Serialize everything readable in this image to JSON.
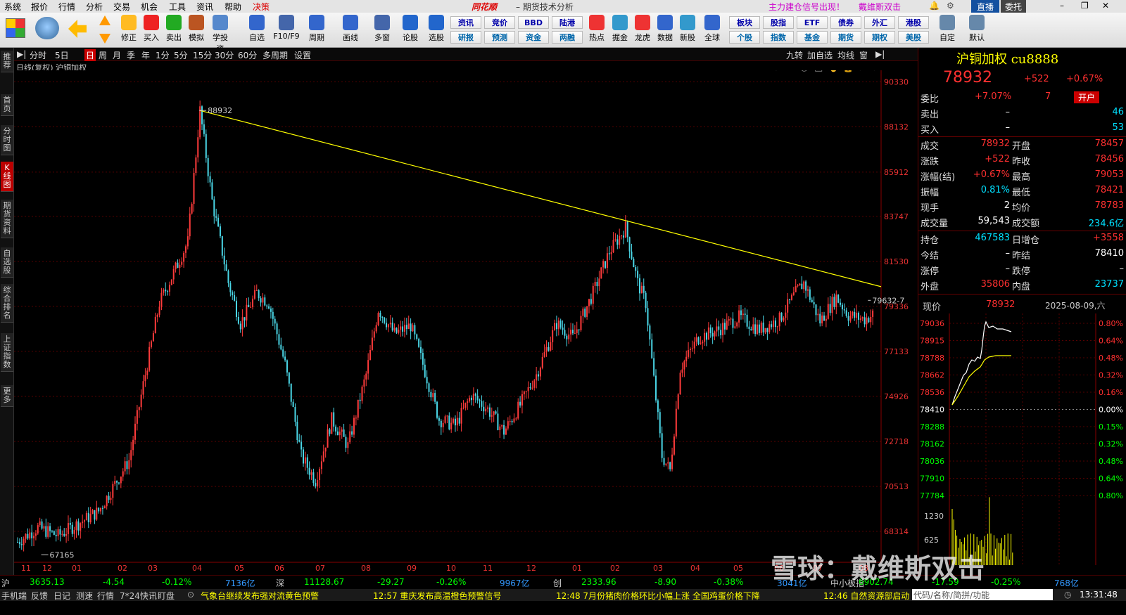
{
  "menu": [
    "系统",
    "报价",
    "行情",
    "分析",
    "交易",
    "机会",
    "工具",
    "资讯",
    "帮助",
    "决策"
  ],
  "app_logo": "同花顺",
  "window_title": "期货技术分析",
  "alert_text": "主力建仓信号出现！",
  "user_name": "戴维斯双击",
  "direct_btn": "直播",
  "entrust_btn": "委托",
  "toolbar_left": [
    {
      "label": "修正",
      "icon": "up-arrow-icon"
    },
    {
      "label": "买入",
      "icon": "buy-icon"
    },
    {
      "label": "卖出",
      "icon": "sell-icon"
    },
    {
      "label": "模拟",
      "icon": "hammer-icon"
    },
    {
      "label": "学投资",
      "icon": "graduation-icon"
    },
    {
      "label": "自选",
      "icon": "star-icon"
    },
    {
      "label": "F10/F9",
      "icon": "f10-icon"
    },
    {
      "label": "周期",
      "icon": "clock-icon"
    },
    {
      "label": "画线",
      "icon": "pen-icon"
    },
    {
      "label": "多窗",
      "icon": "windows-icon"
    },
    {
      "label": "论股",
      "icon": "forum-icon"
    },
    {
      "label": "选股",
      "icon": "select-icon"
    }
  ],
  "toolbar_grid": [
    [
      "资讯",
      "竞价",
      "BBD",
      "陆港"
    ],
    [
      "研报",
      "预测",
      "资金",
      "两融"
    ]
  ],
  "toolbar_mid": [
    "热点",
    "掘金",
    "龙虎",
    "数据",
    "新股",
    "全球"
  ],
  "toolbar_grid2": [
    [
      "板块",
      "股指",
      "ETF",
      "债券",
      "外汇",
      "港股"
    ],
    [
      "个股",
      "指数",
      "基金",
      "期货",
      "期权",
      "美股"
    ]
  ],
  "toolbar_right": [
    "自定",
    "默认"
  ],
  "left_tabs": [
    "推荐",
    "首页",
    "分时图",
    "K线图",
    "期货资料",
    "自选股",
    "综合排名",
    "上证指数",
    "更多"
  ],
  "periods": [
    "分时",
    "5日",
    "日",
    "周",
    "月",
    "季",
    "年",
    "1分",
    "5分",
    "15分",
    "30分",
    "60分",
    "多周期",
    "设置"
  ],
  "period_selected": "日",
  "right_tools": [
    "九转",
    "加自选",
    "均线",
    "窗"
  ],
  "chart_title": "日线(复权)  沪铜加权",
  "quote": {
    "name": "沪铜加权 cu8888",
    "price": "78932",
    "change": "+522",
    "pct": "+0.67%",
    "weibi_k": "委比",
    "weibi_v": "+7.07%",
    "weibi_n": "7",
    "open_btn": "开户",
    "sell_k": "卖出",
    "sell_v": "–",
    "sell_n": "46",
    "buy_k": "买入",
    "buy_v": "–",
    "buy_n": "53",
    "rows": [
      [
        "成交",
        "78932",
        "开盘",
        "78457"
      ],
      [
        "涨跌",
        "+522",
        "昨收",
        "78456"
      ],
      [
        "涨幅(结)",
        "+0.67%",
        "最高",
        "79053"
      ],
      [
        "振幅",
        "0.81%",
        "最低",
        "78421"
      ],
      [
        "现手",
        "2",
        "均价",
        "78783"
      ],
      [
        "成交量",
        "59,543",
        "成交额",
        "234.6亿"
      ],
      [
        "持仓",
        "467583",
        "日增仓",
        "+3558"
      ],
      [
        "今结",
        "–",
        "昨结",
        "78410"
      ],
      [
        "涨停",
        "–",
        "跌停",
        "–"
      ],
      [
        "外盘",
        "35806",
        "内盘",
        "23737"
      ]
    ],
    "now_label": "现价",
    "now_price": "78932",
    "date": "2025-08-09,六"
  },
  "mini_axis_left": [
    "79036",
    "78915",
    "78788",
    "78662",
    "78536",
    "78410",
    "78288",
    "78162",
    "78036",
    "77910",
    "77784"
  ],
  "mini_axis_right": [
    "0.80%",
    "0.64%",
    "0.48%",
    "0.32%",
    "0.16%",
    "0.00%",
    "0.15%",
    "0.32%",
    "0.48%",
    "0.64%",
    "0.80%"
  ],
  "mini_vol_axis": [
    "1230",
    "625"
  ],
  "status": {
    "sh_label": "沪",
    "sh_val": "3635.13",
    "sh_chg": "-4.54",
    "sh_pct": "-0.12%",
    "sh_amt": "7136亿",
    "sz_label": "深",
    "sz_val": "11128.67",
    "sz_chg": "-29.27",
    "sz_pct": "-0.26%",
    "sz_amt": "9967亿",
    "cy_label": "创",
    "cy_val": "2333.96",
    "cy_chg": "-8.90",
    "cy_pct": "-0.38%",
    "cy_amt": "3041亿",
    "zx_label": "中小板指",
    "zx_val": "6902.74",
    "zx_chg": "-17.59",
    "zx_pct": "-0.25%",
    "zx_amt": "768亿"
  },
  "bottom": {
    "tabs": [
      "手机端",
      "反馈",
      "日记",
      "测速",
      "行情",
      "7*24快讯",
      "盯盘"
    ],
    "news": [
      "气象台继续发布强对流黄色预警",
      "12:57 重庆发布高温橙色预警信号",
      "12:48 7月份猪肉价格环比小幅上涨 全国鸡蛋价格下降",
      "12:46 自然资源部启动"
    ],
    "search_placeholder": "代码/名称/简拼/功能",
    "clock": "13:31:48"
  },
  "watermark": "雪球：戴维斯双击",
  "chart_data": {
    "type": "candlestick",
    "y_ticks": [
      90330,
      88132,
      85912,
      83747,
      81530,
      79336,
      77133,
      74926,
      72718,
      70513,
      68314
    ],
    "x_ticks": [
      "11",
      "12",
      "01",
      "02",
      "03",
      "04",
      "05",
      "06",
      "07",
      "08",
      "09",
      "10",
      "11",
      "12",
      "01",
      "02",
      "03",
      "04",
      "05",
      "06",
      "07",
      "08"
    ],
    "annotations": [
      {
        "label": "88932",
        "value": 88932
      },
      {
        "label": "67165",
        "value": 67165
      },
      {
        "label": "79632-7",
        "value": 79632
      }
    ],
    "trendline": {
      "from": 88932,
      "to": 80300
    },
    "keypoints": [
      [
        0,
        67800
      ],
      [
        10,
        68500
      ],
      [
        20,
        68100
      ],
      [
        40,
        69300
      ],
      [
        55,
        71800
      ],
      [
        62,
        75500
      ],
      [
        70,
        79500
      ],
      [
        78,
        81200
      ],
      [
        84,
        82500
      ],
      [
        90,
        88932
      ],
      [
        96,
        84500
      ],
      [
        104,
        80500
      ],
      [
        110,
        78500
      ],
      [
        118,
        80000
      ],
      [
        124,
        79500
      ],
      [
        132,
        76500
      ],
      [
        140,
        72000
      ],
      [
        147,
        70800
      ],
      [
        155,
        73800
      ],
      [
        163,
        72500
      ],
      [
        172,
        76000
      ],
      [
        178,
        79200
      ],
      [
        186,
        78000
      ],
      [
        194,
        78400
      ],
      [
        200,
        76500
      ],
      [
        208,
        73800
      ],
      [
        216,
        73500
      ],
      [
        224,
        75000
      ],
      [
        232,
        74300
      ],
      [
        240,
        73200
      ],
      [
        248,
        74500
      ],
      [
        256,
        76000
      ],
      [
        266,
        78500
      ],
      [
        274,
        77800
      ],
      [
        284,
        80000
      ],
      [
        292,
        82000
      ],
      [
        300,
        83200
      ],
      [
        306,
        80500
      ],
      [
        310,
        79500
      ],
      [
        318,
        72000
      ],
      [
        322,
        71300
      ],
      [
        327,
        76300
      ],
      [
        336,
        77800
      ],
      [
        346,
        78200
      ],
      [
        356,
        78800
      ],
      [
        366,
        78200
      ],
      [
        376,
        78700
      ],
      [
        384,
        80000
      ],
      [
        388,
        80500
      ],
      [
        396,
        78600
      ],
      [
        404,
        79800
      ],
      [
        410,
        78900
      ],
      [
        418,
        78700
      ],
      [
        422,
        78932
      ]
    ]
  }
}
